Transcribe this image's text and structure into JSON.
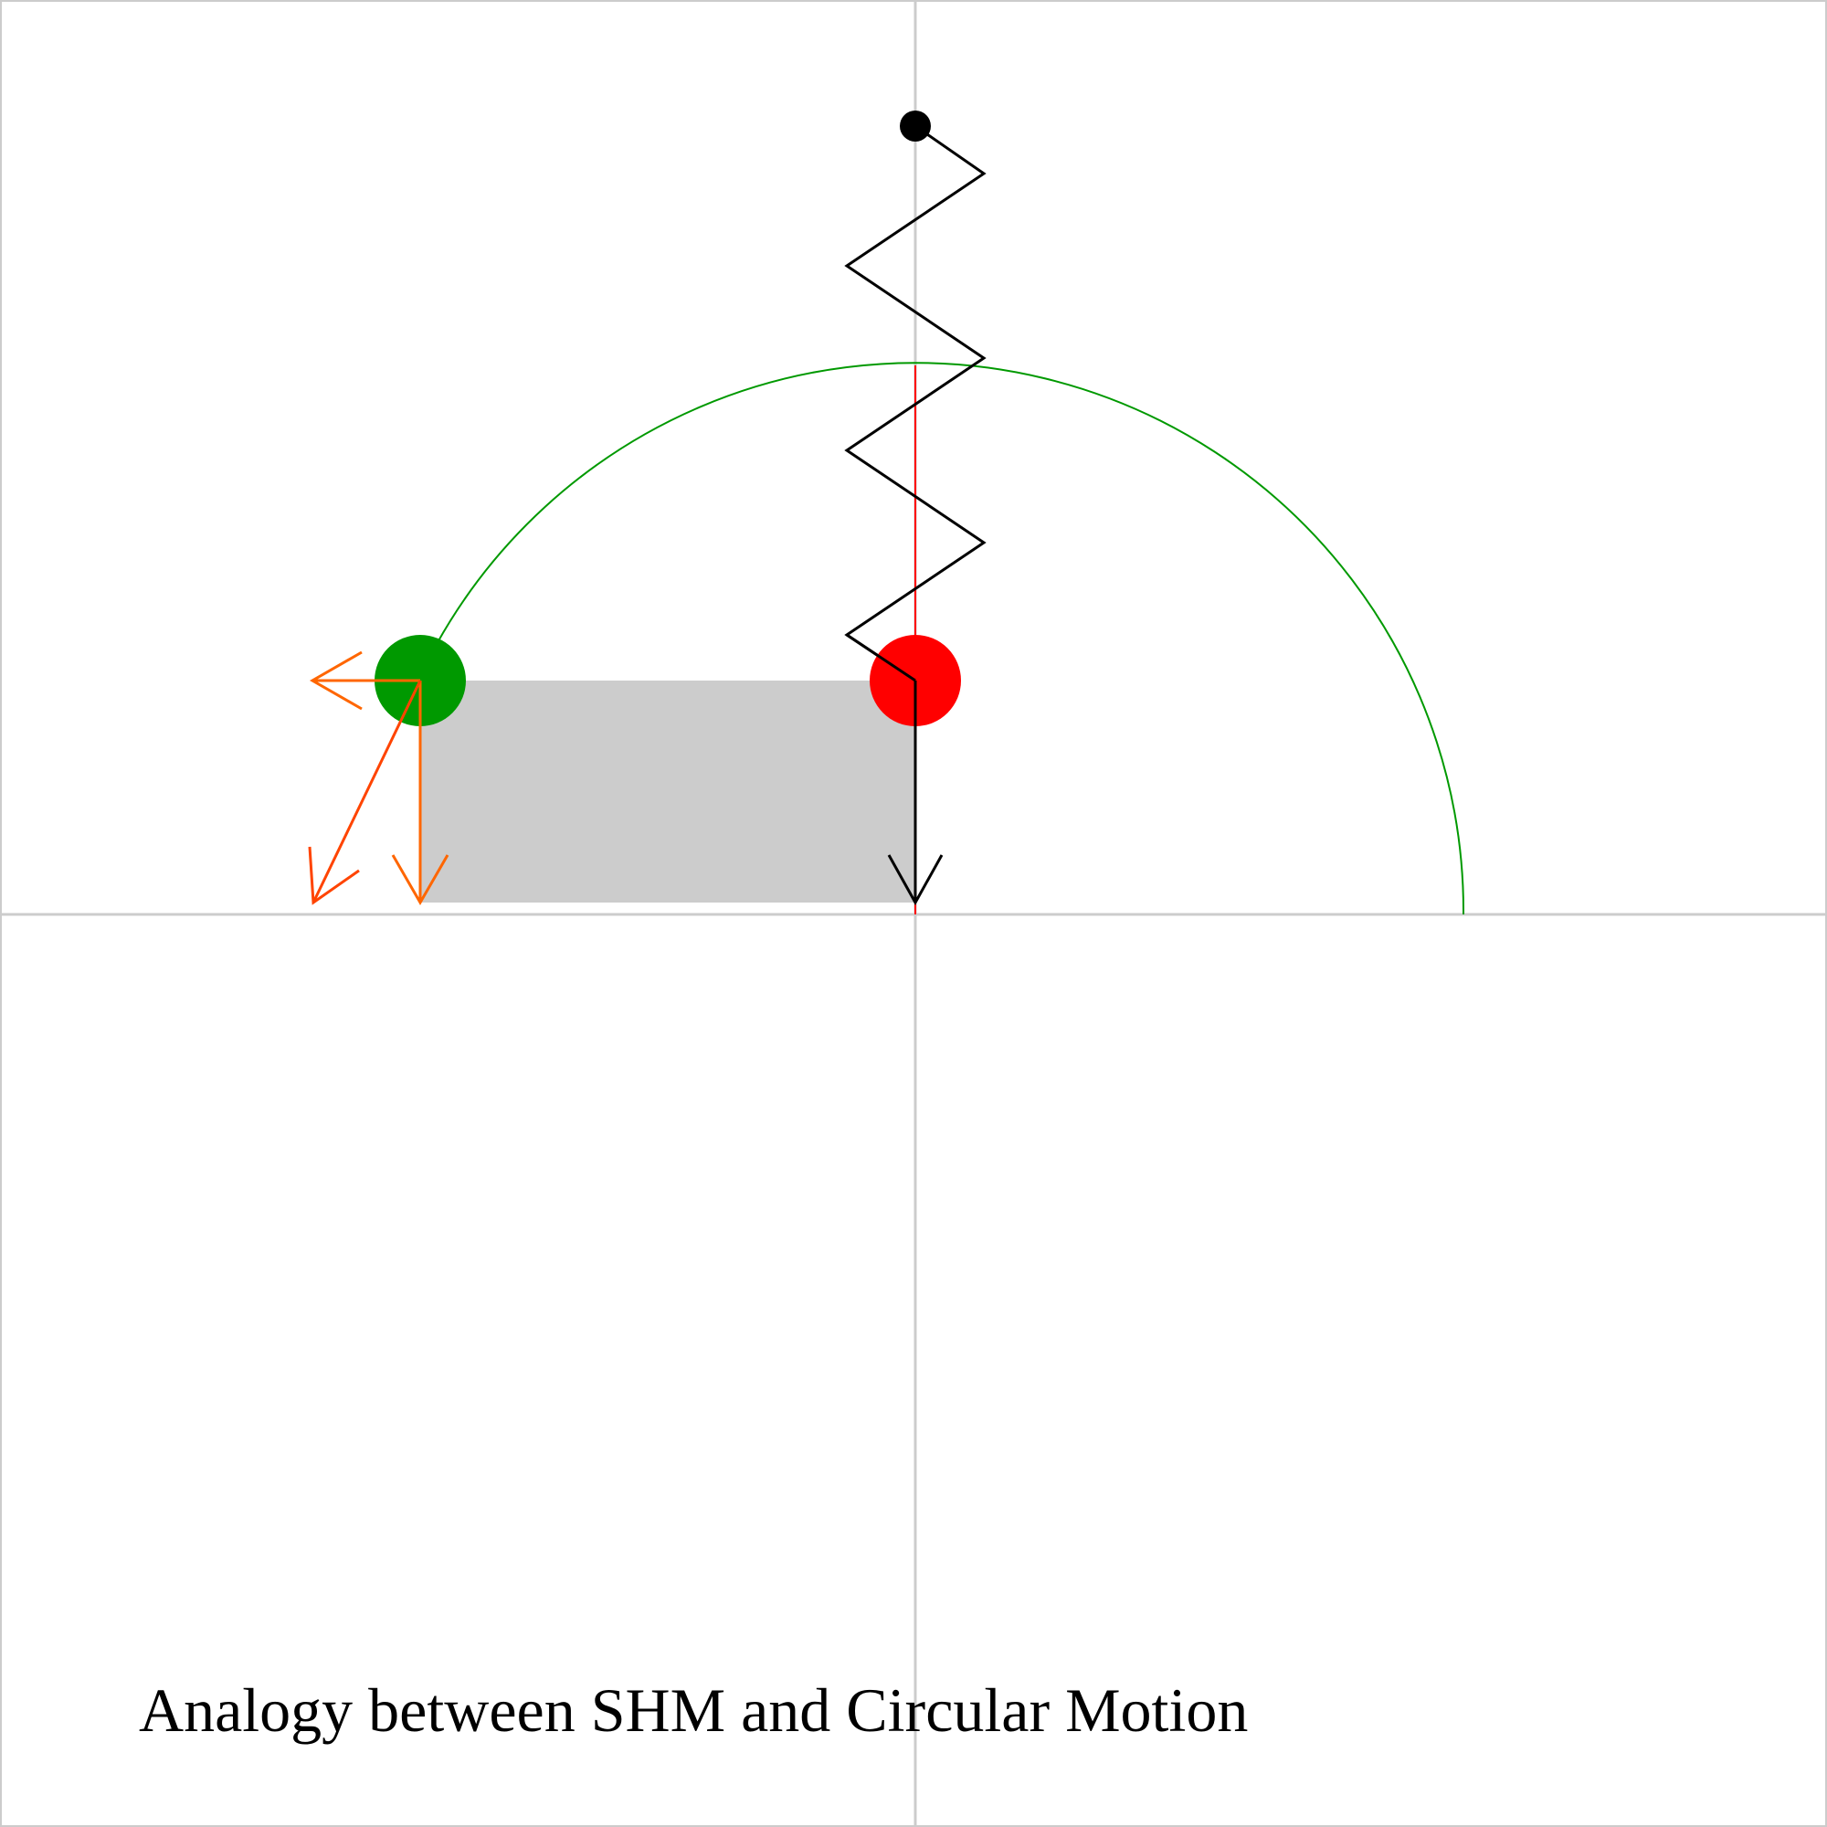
{
  "caption": "Analogy between SHM and Circular Motion",
  "colors": {
    "background": "#ffffff",
    "axes": "#cccccc",
    "circle_path": "#009900",
    "circle_ball": "#009900",
    "shm_ball": "#ff0000",
    "projection_line": "#ff0000",
    "spring": "#000000",
    "anchor": "#000000",
    "shm_arrow": "#000000",
    "projection_band": "#cccccc",
    "circle_velocity": "#ff6600",
    "circle_acceleration": "#ff4400"
  },
  "icons": {
    "anchor": "anchor-dot",
    "spring": "zigzag-spring",
    "circle_particle": "green-ball",
    "shm_particle": "red-ball"
  },
  "state": {
    "angle_deg": 155,
    "amplitude_units": 1,
    "spring_coils": 4
  }
}
